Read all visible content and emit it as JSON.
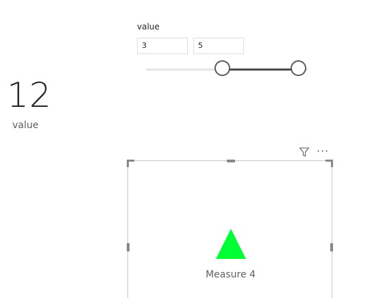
{
  "card": {
    "value": "12",
    "label": "value"
  },
  "slicer": {
    "title": "value",
    "min_input": "3",
    "max_input": "5",
    "range": {
      "low_fraction": 0.474,
      "high_fraction": 0.943
    }
  },
  "visual_header": {
    "filter_icon": "filter-icon",
    "more_options": "···"
  },
  "kpi": {
    "indicator_icon": "triangle-up-icon",
    "indicator_color": "#00ff33",
    "label": "Measure 4"
  }
}
